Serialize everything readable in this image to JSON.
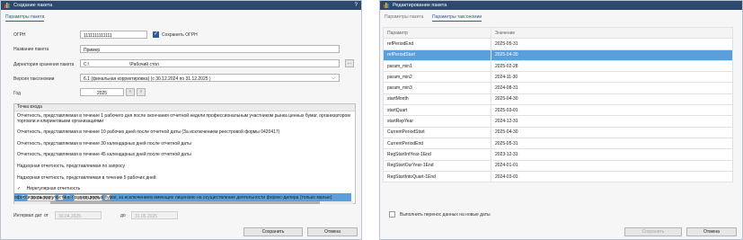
{
  "left": {
    "title": "Создание пакета",
    "help": "?",
    "tab": "Параметры пакета",
    "ogrn": {
      "label": "ОГРН",
      "value": "1111111111111",
      "save_label": "Сохранить ОГРН"
    },
    "name": {
      "label": "Название пакета",
      "value": "Пример"
    },
    "dir": {
      "label": "Директория хранения пакета",
      "value": "C:\\",
      "value2": "\\Рабочий стол",
      "browse": "..."
    },
    "taxonomy": {
      "label": "Версия таксономии",
      "value": "6.1 (финальная корректировка) (с 30.12.2024 по 31.12.2025 )"
    },
    "year": {
      "label": "Год",
      "value": "2025"
    },
    "list_header": "Точка входа",
    "items": [
      "Отчетность, представляемая в течение 1 рабочего дня после окончания отчетной недели профессиональным участником рынка ценных бумаг, организатором",
      "торговли и клиринговыми организациями",
      "Отчетность, представляемая в течение 10 рабочих дней после отчетной даты (За исключением реестровой формы 0420417)",
      "Отчетность, представляемая в течение 30 календарных дней после отчетной даты",
      "Отчетность, представляемая в течение 45 календарных дней после отчетной даты",
      "Надзорная отчетность, представляемая по запросу",
      "Надзорная отчетность, представляемая в течение 5 рабочих дней"
    ],
    "group_label": "Нерегулярная отчетность",
    "range": {
      "from_label": "С",
      "from": "30.04.2025",
      "to_label": "По",
      "to": "31.05.2025"
    },
    "group_tail": "офессиональные участники рынка ценных бумаг, за исключением имеющих лицензию на осуществление деятельности форекс-дилера (только малые)",
    "interval": {
      "label": "Интервал дат",
      "from_label": "от",
      "from": "30.04.2025",
      "to_label": "до",
      "to": "31.05.2025"
    },
    "save": "Сохранить",
    "cancel": "Отмена"
  },
  "right": {
    "title": "Редактирование пакета",
    "tabs": [
      "Параметры пакета",
      "Параметры таксономии"
    ],
    "columns": [
      "Параметр",
      "Значение"
    ],
    "rows": [
      [
        "refPeriodEnd",
        "2025-05-31"
      ],
      [
        "refPeriodStart",
        "2025-04-30"
      ],
      [
        "param_min1",
        "2025-02-28"
      ],
      [
        "param_min2",
        "2024-11-30"
      ],
      [
        "param_min3",
        "2024-08-31"
      ],
      [
        "startMonth",
        "2025-04-30"
      ],
      [
        "startQuart",
        "2025-03-01"
      ],
      [
        "startRepYear",
        "2024-12-31"
      ],
      [
        "CurrentPeriodStart",
        "2025-04-30"
      ],
      [
        "CurrentPeriodEnd",
        "2025-05-31"
      ],
      [
        "RegStartIntYear-1End",
        "2023-12-31"
      ],
      [
        "RegStartOurYear-1End",
        "2024-01-01"
      ],
      [
        "RegStartIntoQuart-1End",
        "2024-03-01"
      ]
    ],
    "transfer_label": "Выполнить перенос данных на новые даты",
    "save": "Сохранить",
    "cancel": "Отмена"
  },
  "colors": {
    "titlebar": "#2d4a6e",
    "accent": "#2b5d96",
    "selection": "#5a9fdc"
  }
}
